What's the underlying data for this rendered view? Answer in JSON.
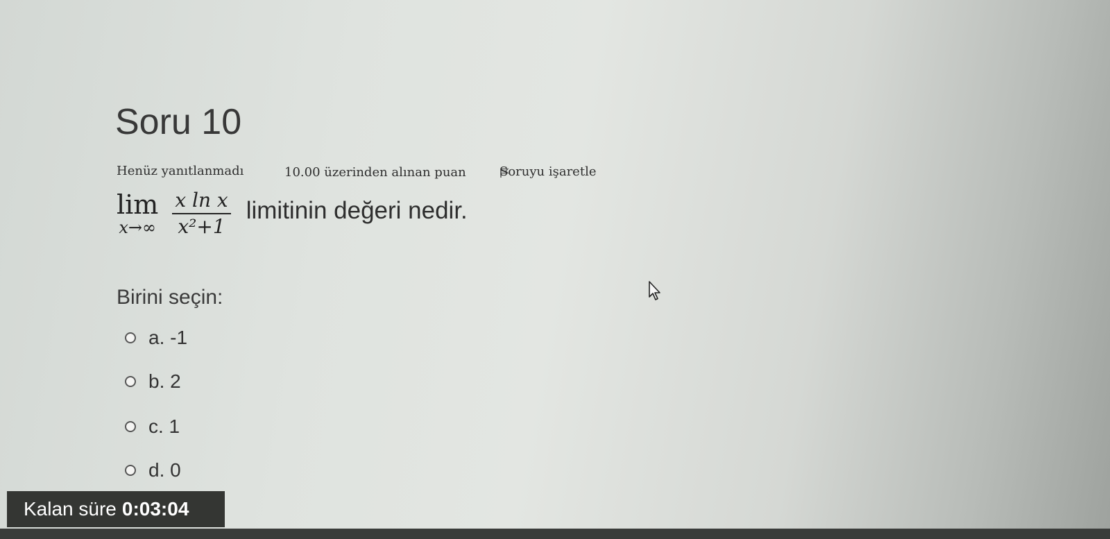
{
  "question": {
    "title": "Soru 10",
    "state": "Henüz yanıtlanmadı",
    "grade": "10.00 üzerinden alınan puan",
    "flag_label": "Soruyu işaretle",
    "flag_icon": "flag-icon",
    "math": {
      "lim": "lim",
      "lim_sub": "x→∞",
      "numerator": "x ln x",
      "denominator": "x²+1"
    },
    "text": "limitinin değeri nedir.",
    "prompt": "Birini seçin:",
    "options": [
      {
        "label": "a. -1",
        "selected": false
      },
      {
        "label": "b. 2",
        "selected": false
      },
      {
        "label": "c. 1",
        "selected": false
      },
      {
        "label": "d. 0",
        "selected": false
      }
    ]
  },
  "timer": {
    "label": "Kalan süre",
    "value": "0:03:04"
  },
  "cursor_icon": "mouse-pointer-icon"
}
